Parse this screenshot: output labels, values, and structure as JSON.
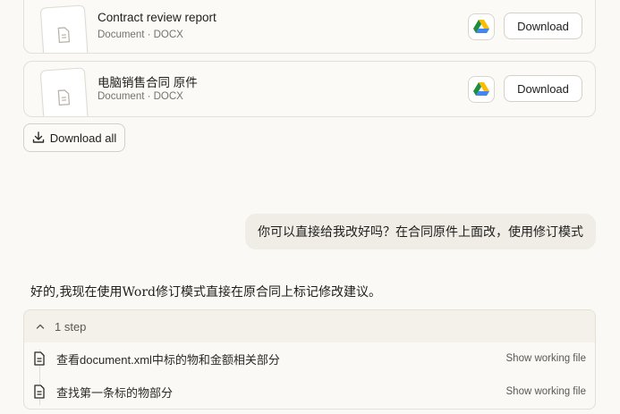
{
  "files": [
    {
      "title": "Contract review report",
      "meta": "Document · DOCX",
      "download_label": "Download"
    },
    {
      "title": "电脑销售合同 原件",
      "meta": "Document · DOCX",
      "download_label": "Download"
    }
  ],
  "download_all_label": "Download all",
  "user_message": "你可以直接给我改好吗？在合同原件上面改，使用修订模式",
  "assistant_message": "好的,我现在使用Word修订模式直接在原合同上标记修改建议。",
  "steps": {
    "count_label": "1 step",
    "items": [
      {
        "label": "查看document.xml中标的物和金额相关部分",
        "link": "Show working file"
      },
      {
        "label": "查找第一条标的物部分",
        "link": "Show working file"
      }
    ]
  },
  "colors": {
    "background": "#faf9f5",
    "card_border": "#e3e0d6",
    "user_bubble": "#efede5",
    "drive_green": "#1e8e3e",
    "drive_yellow": "#fbbc04",
    "drive_blue": "#4285f4"
  },
  "icons": [
    "document-icon",
    "google-drive-icon",
    "download-icon",
    "chevron-up-icon",
    "file-icon"
  ]
}
